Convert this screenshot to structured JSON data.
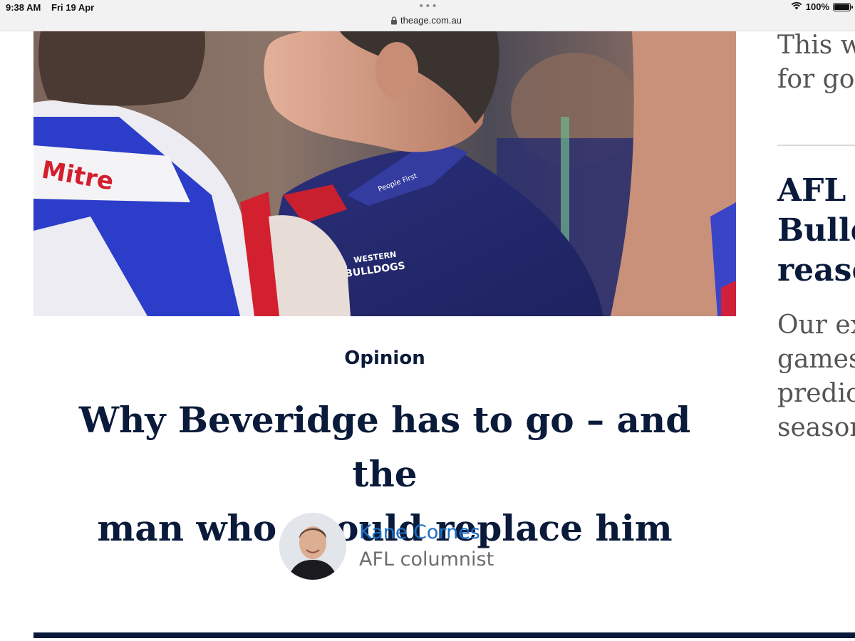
{
  "status_bar": {
    "time": "9:38 AM",
    "date": "Fri 19 Apr",
    "url": "theage.com.au",
    "battery": "100%",
    "icons": [
      "lock-icon",
      "wifi-icon",
      "battery-icon",
      "more-dots-icon"
    ]
  },
  "hero_image": {
    "jersey_brand": "Western Bulldogs",
    "jersey_text": "WESTERN BULLDOGS",
    "collar_text": "People First Bank"
  },
  "article": {
    "section": "Opinion",
    "headline_lines": [
      "Why Beveridge has to go – and the",
      "man who should replace him"
    ],
    "author": {
      "name": "Kane Cornes",
      "role": "AFL columnist"
    }
  },
  "sidebar": {
    "teaser_lines": [
      "This w",
      "for goa"
    ],
    "headline_lines": [
      "AFL r",
      "Bulld",
      "reaso"
    ],
    "body_lines": [
      "Our ex",
      "games",
      "predict",
      "season"
    ]
  },
  "colors": {
    "navy": "#0a1a3a",
    "link_blue": "#1b6fc8",
    "muted_gray": "#6d6d6d"
  }
}
